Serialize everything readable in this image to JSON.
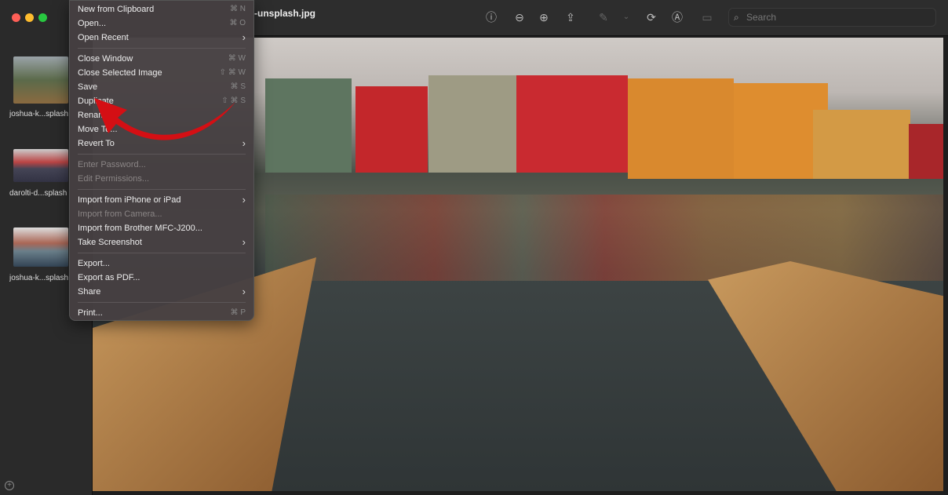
{
  "window": {
    "title": "-unsplash.jpg"
  },
  "sidebar": {
    "items": [
      {
        "label": "joshua-k...splash"
      },
      {
        "label": "darolti-d...splash"
      },
      {
        "label": "joshua-k...splash"
      }
    ],
    "add_icon": "plus-circle-icon"
  },
  "toolbar": {
    "icons": [
      "info-icon",
      "zoom-out-icon",
      "zoom-in-icon",
      "share-icon",
      "markup-pen-icon",
      "chevron-down-icon",
      "rotate-icon",
      "markup-icon",
      "signature-icon"
    ],
    "search_placeholder": "Search"
  },
  "menu": {
    "groups": [
      [
        {
          "label": "New from Clipboard",
          "shortcut": "⌘ N"
        },
        {
          "label": "Open...",
          "shortcut": "⌘ O"
        },
        {
          "label": "Open Recent",
          "submenu": true
        }
      ],
      [
        {
          "label": "Close Window",
          "shortcut": "⌘ W"
        },
        {
          "label": "Close Selected Image",
          "shortcut": "⇧ ⌘ W"
        },
        {
          "label": "Save",
          "shortcut": "⌘ S"
        },
        {
          "label": "Duplicate",
          "shortcut": "⇧ ⌘ S"
        },
        {
          "label": "Rename..."
        },
        {
          "label": "Move To..."
        },
        {
          "label": "Revert To",
          "submenu": true
        }
      ],
      [
        {
          "label": "Enter Password...",
          "disabled": true
        },
        {
          "label": "Edit Permissions...",
          "disabled": true
        }
      ],
      [
        {
          "label": "Import from iPhone or iPad",
          "submenu": true
        },
        {
          "label": "Import from Camera...",
          "disabled": true
        },
        {
          "label": "Import from Brother MFC-J200..."
        },
        {
          "label": "Take Screenshot",
          "submenu": true
        }
      ],
      [
        {
          "label": "Export..."
        },
        {
          "label": "Export as PDF..."
        },
        {
          "label": "Share",
          "submenu": true
        }
      ],
      [
        {
          "label": "Print...",
          "shortcut": "⌘ P"
        }
      ]
    ]
  },
  "colors": {
    "annotation_arrow": "#d40f14",
    "menu_bg": "#464042"
  }
}
